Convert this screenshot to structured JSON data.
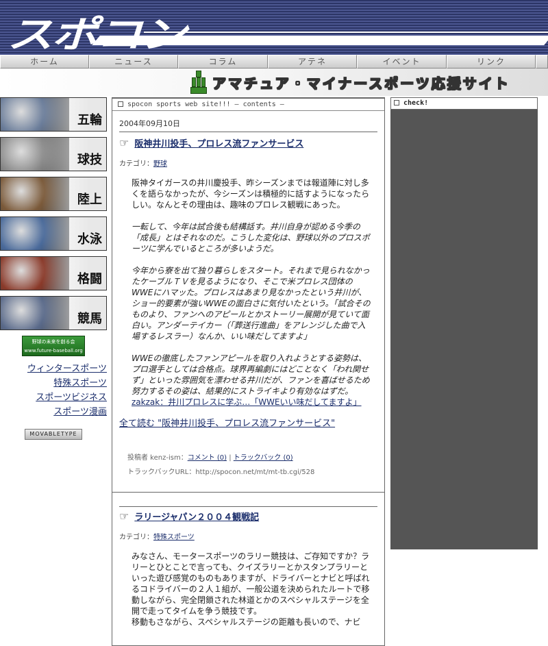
{
  "header": {
    "logo": "スポコン"
  },
  "nav": {
    "items": [
      "ホーム",
      "ニュース",
      "コラム",
      "アテネ",
      "イベント",
      "リンク"
    ]
  },
  "tagline": "アマチュア・マイナースポーツ応援サイト",
  "sidebar": {
    "sports": [
      {
        "label": "五輪",
        "color": "#6b7d9a"
      },
      {
        "label": "球技",
        "color": "#8a8a8a"
      },
      {
        "label": "陸上",
        "color": "#7b5a3a"
      },
      {
        "label": "水泳",
        "color": "#4a6a9a"
      },
      {
        "label": "格闘",
        "color": "#8a3a2a"
      },
      {
        "label": "競馬",
        "color": "#5a6a8a"
      }
    ],
    "banner": {
      "line1": "野球の未来を創る会",
      "line2": "www.future-baseball.org"
    },
    "links": [
      "ウィンタースポーツ",
      "特殊スポーツ",
      "スポーツビジネス",
      "スポーツ漫画"
    ],
    "mt_badge": "MOVABLETYPE"
  },
  "main": {
    "header": "spocon sports web site!!! — contents —",
    "entries": [
      {
        "date": "2004年09月10日",
        "title": "阪神井川投手、プロレス流ファンサービス",
        "category_label": "カテゴリ：",
        "category": "野球",
        "p1": "阪神タイガースの井川慶投手、昨シーズンまでは報道陣に対し多くを語らなかったが、今シーズンは積極的に話すようになったらしい。なんとその理由は、趣味のプロレス観戦にあった。",
        "p2": "一転して、今年は試合後も結構話す。井川自身が認める今季の「成長」とはそれなのだ。こうした変化は、野球以外のプロスポーツに学んでいるところが多いようだ。",
        "p3": "今年から寮を出て独り暮らしをスタート。それまで見られなかったケーブルＴＶを見るようになり、そこで米プロレス団体のWWEにハマッた。プロレスはあまり見なかったという井川が、ショー的要素が強いWWEの面白さに気付いたという。「試合そのものより、ファンへのアピールとかストーリー展開が見ていて面白い。アンダーテイカー（「葬送行進曲」をアレンジした曲で入場するレスラー）なんか、いい味だしてますよ」",
        "p4": "WWEの徹底したファンアピールを取り入れようとする姿勢は、プロ選手としては合格点。球界再編劇にはどことなく「われ関せず」といった雰囲気を漂わせる井川だが、ファンを喜ばせるため努力するその姿は、結果的にストライキより有効なはずだ。",
        "source": "zakzak：井川プロレスに学ぶ…「WWEいい味だしてますよ」",
        "readmore": "全て読む \"阪神井川投手、プロレス流ファンサービス\"",
        "author_label": "投稿者 kenz-ism：",
        "comments": "コメント (0)",
        "pipe": " | ",
        "trackbacks": "トラックバック (0)",
        "tb_url": "トラックバックURL：http://spocon.net/mt/mt-tb.cgi/528"
      },
      {
        "title": "ラリージャパン２００４観戦記",
        "category_label": "カテゴリ：",
        "category": "特殊スポーツ",
        "p1": "みなさん、モータースポーツのラリー競技は、ご存知ですか？ラリーとひとことで言っても、クイズラリーとかスタンプラリーといった遊び感覚のものもありますが、ドライバーとナビと呼ばれるコドライバーの２人１組が、一般公道を決められたルートで移動しながら、完全閉鎖された林道とかのスペシャルステージを全開で走ってタイムを争う競技です。",
        "p2": "移動もさながら、スペシャルステージの距離も長いので、ナビ"
      }
    ]
  },
  "check": {
    "header": "check!"
  }
}
